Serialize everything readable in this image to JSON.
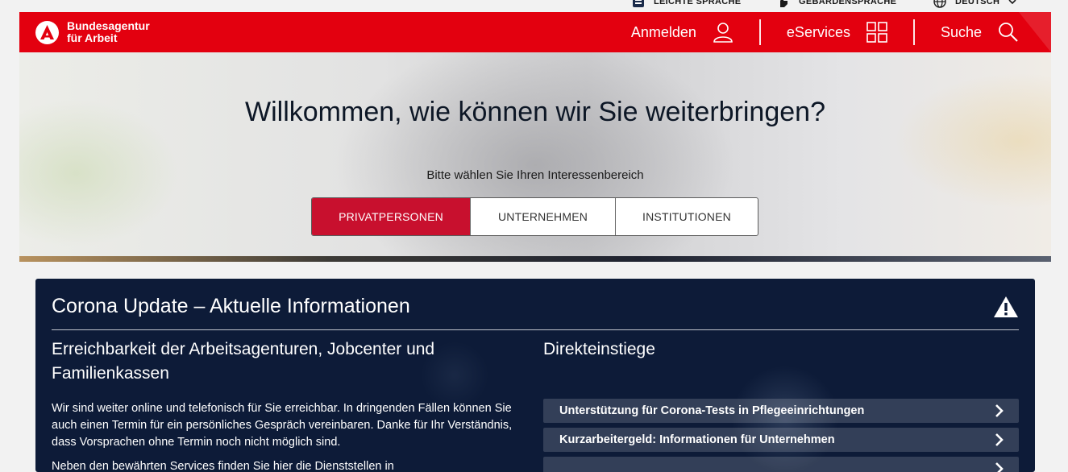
{
  "utility": {
    "easy_language": "LEICHTE SPRACHE",
    "sign_language": "GEBÄRDENSPRACHE",
    "language": "DEUTSCH"
  },
  "header": {
    "logo_line1": "Bundesagentur",
    "logo_line2": "für Arbeit",
    "nav": {
      "login": "Anmelden",
      "eservices": "eServices",
      "search": "Suche"
    },
    "brand_color": "#e3000f"
  },
  "hero": {
    "title": "Willkommen, wie können wir Sie weiterbringen?",
    "subtitle": "Bitte wählen Sie Ihren Interessenbereich",
    "tabs": [
      {
        "label": "PRIVATPERSONEN",
        "active": true
      },
      {
        "label": "UNTERNEHMEN",
        "active": false
      },
      {
        "label": "INSTITUTIONEN",
        "active": false
      }
    ]
  },
  "corona": {
    "title": "Corona Update – Aktuelle Informationen",
    "left": {
      "heading": "Erreichbarkeit der Arbeitsagenturen, Jobcenter und Familienkassen",
      "paragraph": "Wir sind weiter online und telefonisch für Sie erreichbar. In dringenden Fällen können Sie auch einen Termin für ein persönliches Gespräch vereinbaren. Danke für Ihr Verständnis, dass Vorsprachen ohne Termin noch nicht möglich sind.",
      "paragraph2_partial": "Neben den bewährten Services finden Sie hier die Dienststellen in"
    },
    "right": {
      "heading": "Direkteinstiege",
      "links": [
        "Unterstützung für Corona-Tests in Pflegeeinrichtungen",
        "Kurzarbeitergeld: Informationen für Unternehmen",
        ""
      ]
    }
  }
}
